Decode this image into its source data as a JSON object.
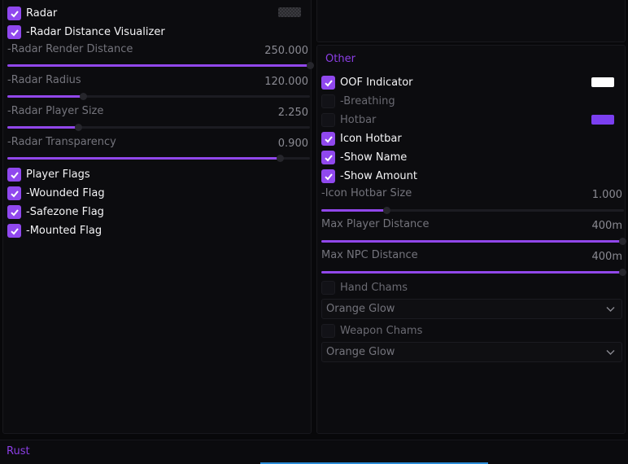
{
  "left": {
    "radar": {
      "label": "Radar",
      "checked": true
    },
    "radar_distance_visualizer": {
      "label": "-Radar Distance Visualizer",
      "checked": true
    },
    "sliders": [
      {
        "label": "-Radar Render Distance",
        "value": "250.000",
        "fraction": 1.0
      },
      {
        "label": "-Radar Radius",
        "value": "120.000",
        "fraction": 0.25
      },
      {
        "label": "-Radar Player Size",
        "value": "2.250",
        "fraction": 0.235
      },
      {
        "label": "-Radar Transparency",
        "value": "0.900",
        "fraction": 0.9
      }
    ],
    "flags": [
      {
        "label": "Player Flags",
        "checked": true
      },
      {
        "label": "-Wounded Flag",
        "checked": true
      },
      {
        "label": "-Safezone Flag",
        "checked": true
      },
      {
        "label": "-Mounted Flag",
        "checked": true
      }
    ]
  },
  "right": {
    "section_title": "Other",
    "oof_indicator": {
      "label": "OOF Indicator",
      "checked": true,
      "color": "#ffffff"
    },
    "breathing": {
      "label": "-Breathing",
      "checked": false
    },
    "hotbar": {
      "label": "Hotbar",
      "checked": false,
      "color": "#7b3ff0"
    },
    "icon_hotbar": {
      "label": "Icon Hotbar",
      "checked": true
    },
    "show_name": {
      "label": "-Show Name",
      "checked": true
    },
    "show_amount": {
      "label": "-Show Amount",
      "checked": true
    },
    "sliders": [
      {
        "label": "-Icon Hotbar Size",
        "value": "1.000",
        "fraction": 0.215
      },
      {
        "label": "Max Player Distance",
        "value": "400m",
        "fraction": 1.0
      },
      {
        "label": "Max NPC Distance",
        "value": "400m",
        "fraction": 1.0
      }
    ],
    "hand_chams": {
      "label": "Hand Chams",
      "checked": false,
      "selected": "Orange Glow"
    },
    "weapon_chams": {
      "label": "Weapon Chams",
      "checked": false,
      "selected": "Orange Glow"
    }
  },
  "footer": {
    "title": "Rust"
  },
  "colors": {
    "accent": "#9048ee",
    "footer_bar": "#2a8bd6"
  }
}
